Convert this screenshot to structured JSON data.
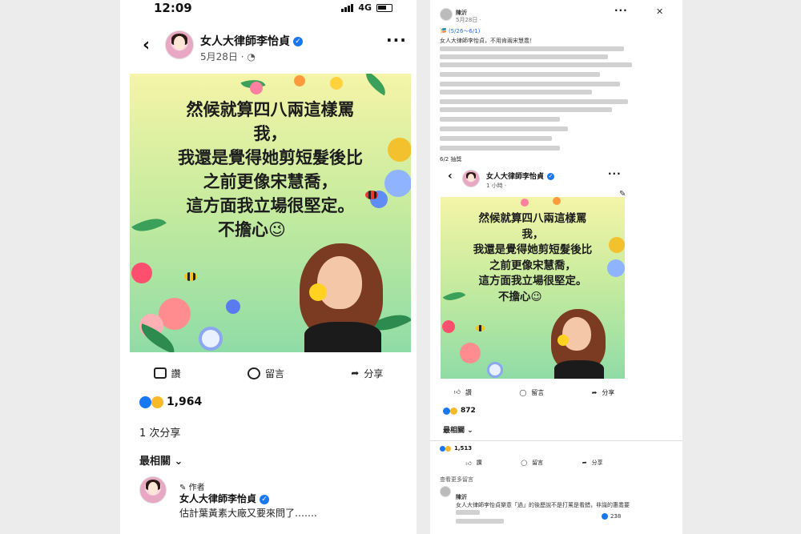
{
  "left": {
    "status": {
      "time": "12:09",
      "network": "4G"
    },
    "header": {
      "page_name": "女人大律師李怡貞",
      "date": "5月28日 ·",
      "verified": "✓"
    },
    "post_image": {
      "lines": [
        "然候就算四八兩這樣罵",
        "我，",
        "我還是覺得她剪短髮後比",
        "之前更像宋慧喬，",
        "這方面我立場很堅定。",
        "不擔心😉"
      ]
    },
    "actions": {
      "like": "讚",
      "comment": "留言",
      "share": "分享"
    },
    "reactions": {
      "count": "1,964"
    },
    "shares": "1 次分享",
    "sort": "最相關",
    "comment": {
      "author_tag": "作者",
      "author": "女人大律師李怡貞",
      "text": "估計葉黃素大廠又要來問了……."
    }
  },
  "right": {
    "top_post": {
      "author": "陳沂",
      "date": "5月28日 ·",
      "headline": "🎏 (5/26～6/1)",
      "lines": [
        "女人大律師李怡貞，不用肯兩宋慧喬！",
        "6/2 抽獎"
      ]
    },
    "shared": {
      "page_name": "女人大律師李怡貞",
      "date": "1 小時 ·",
      "lines": [
        "然候就算四八兩這樣罵",
        "我，",
        "我還是覺得她剪短髮後比",
        "之前更像宋慧喬，",
        "這方面我立場很堅定。",
        "不擔心😉"
      ],
      "actions": {
        "like": "讚",
        "comment": "留言",
        "share": "分享"
      },
      "reactions": "872",
      "sort": "最相關"
    },
    "footer": {
      "reactions": "1,513",
      "more_comments": "查看更多留言",
      "commenter": "陳沂",
      "comment_text": "女人大律師李怡貞樂意「過」的後歷說不是打罵是看錯，非識的惠喬要",
      "comment_count": "238"
    }
  },
  "colors": {
    "facebook_blue": "#1877f2",
    "bg": "#ececec"
  }
}
